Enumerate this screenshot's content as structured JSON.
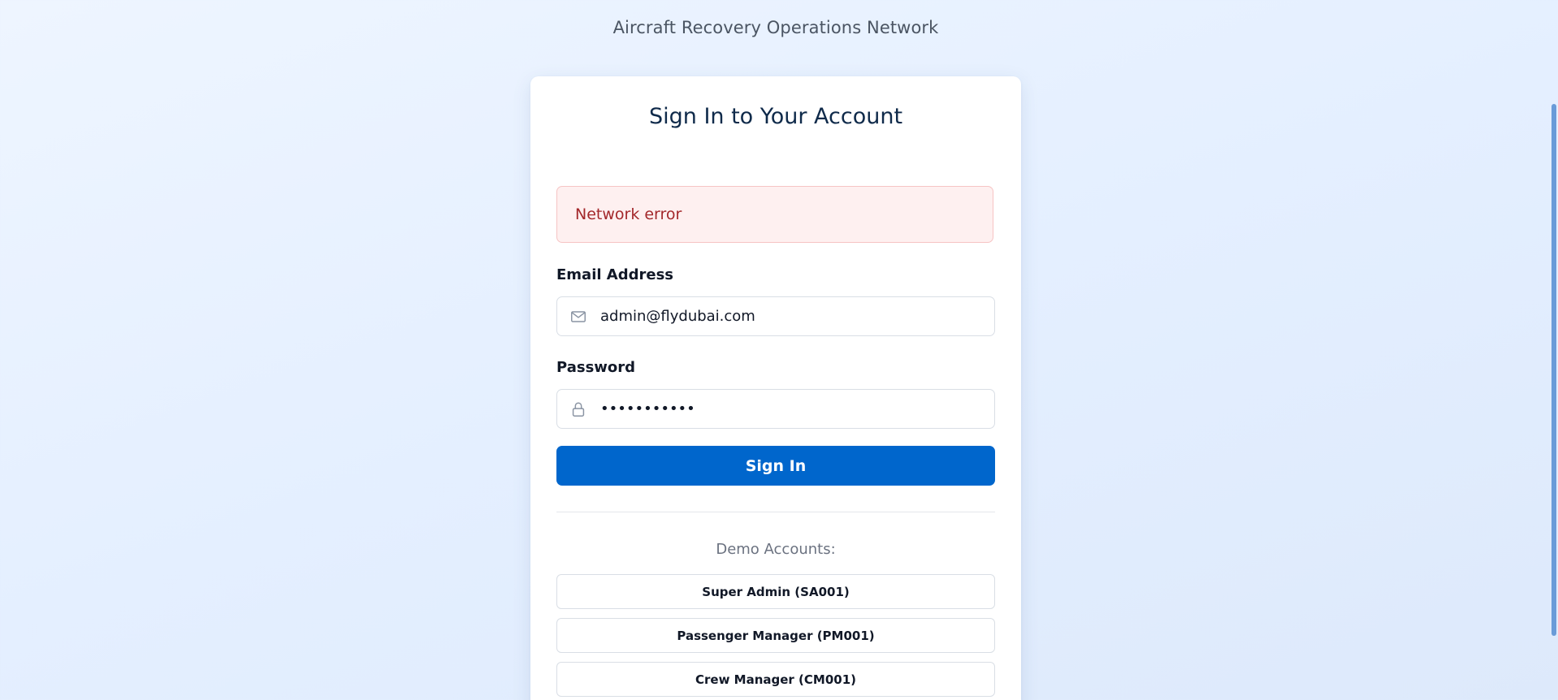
{
  "header": {
    "subtitle": "Aircraft Recovery Operations Network"
  },
  "login": {
    "title": "Sign In to Your Account",
    "error_message": "Network error",
    "email": {
      "label": "Email Address",
      "value": "admin@flydubai.com",
      "icon": "mail-icon"
    },
    "password": {
      "label": "Password",
      "value": "•••••••••••",
      "icon": "lock-icon"
    },
    "submit_label": "Sign In"
  },
  "demo": {
    "title": "Demo Accounts:",
    "accounts": [
      {
        "label": "Super Admin (SA001)"
      },
      {
        "label": "Passenger Manager (PM001)"
      },
      {
        "label": "Crew Manager (CM001)"
      }
    ]
  },
  "colors": {
    "primary": "#0066cc",
    "error_text": "#a3282b",
    "error_bg": "#fef0f0"
  }
}
